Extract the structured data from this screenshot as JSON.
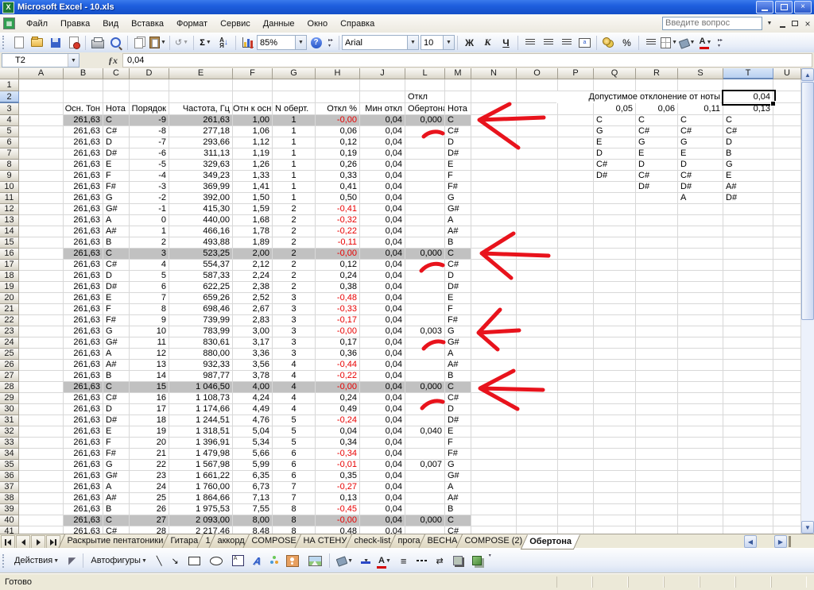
{
  "window": {
    "title": "Microsoft Excel - 10.xls"
  },
  "menu": {
    "items": [
      "Файл",
      "Правка",
      "Вид",
      "Вставка",
      "Формат",
      "Сервис",
      "Данные",
      "Окно",
      "Справка"
    ],
    "question_placeholder": "Введите вопрос"
  },
  "toolbar": {
    "zoom": "85%",
    "font_name": "Arial",
    "font_size": "10",
    "sum": "Σ",
    "sort_a": "А",
    "sort_z": "Я",
    "bold": "Ж",
    "italic": "К",
    "underline": "Ч",
    "percent": "%"
  },
  "formula_bar": {
    "name_box": "T2",
    "fx": "ƒx",
    "value": "0,04"
  },
  "grid": {
    "columns": [
      "A",
      "B",
      "C",
      "D",
      "E",
      "F",
      "G",
      "H",
      "J",
      "L",
      "M",
      "N",
      "O",
      "P",
      "Q",
      "R",
      "S",
      "T",
      "U"
    ],
    "selected_column": "T",
    "selected_row_header": 2,
    "base_tone": "261,63",
    "min_dev": "0,04",
    "row2": {
      "l": "Откл",
      "tolerance_label": "Допустимое отклонение от ноты",
      "t": "0,04"
    },
    "row3": {
      "b": "Осн. Тон",
      "c": "Нота",
      "d": "Порядок",
      "e": "Частота, Гц",
      "f": "Отн к осн",
      "g": "N оберт.",
      "h": "Откл %",
      "j": "Мин откл",
      "l": "Обертона",
      "m": "Нота",
      "q": "0,05",
      "r": "0,06",
      "s": "0,11",
      "t": "0,13"
    },
    "rows": [
      {
        "n": 4,
        "note": "C",
        "ord": "-9",
        "freq": "261,63",
        "ratio": "1,00",
        "ov": "1",
        "dev": "-0,00",
        "ldev": "0,000",
        "gray": true,
        "q": "C",
        "r": "C",
        "s": "C",
        "t": "C"
      },
      {
        "n": 5,
        "note": "C#",
        "ord": "-8",
        "freq": "277,18",
        "ratio": "1,06",
        "ov": "1",
        "dev": "0,06",
        "q": "G",
        "r": "C#",
        "s": "C#",
        "t": "C#"
      },
      {
        "n": 6,
        "note": "D",
        "ord": "-7",
        "freq": "293,66",
        "ratio": "1,12",
        "ov": "1",
        "dev": "0,12",
        "q": "E",
        "r": "G",
        "s": "G",
        "t": "D"
      },
      {
        "n": 7,
        "note": "D#",
        "ord": "-6",
        "freq": "311,13",
        "ratio": "1,19",
        "ov": "1",
        "dev": "0,19",
        "q": "D",
        "r": "E",
        "s": "E",
        "t": "B"
      },
      {
        "n": 8,
        "note": "E",
        "ord": "-5",
        "freq": "329,63",
        "ratio": "1,26",
        "ov": "1",
        "dev": "0,26",
        "q": "C#",
        "r": "D",
        "s": "D",
        "t": "G"
      },
      {
        "n": 9,
        "note": "F",
        "ord": "-4",
        "freq": "349,23",
        "ratio": "1,33",
        "ov": "1",
        "dev": "0,33",
        "q": "D#",
        "r": "C#",
        "s": "C#",
        "t": "E"
      },
      {
        "n": 10,
        "note": "F#",
        "ord": "-3",
        "freq": "369,99",
        "ratio": "1,41",
        "ov": "1",
        "dev": "0,41",
        "r": "D#",
        "s": "D#",
        "t": "A#"
      },
      {
        "n": 11,
        "note": "G",
        "ord": "-2",
        "freq": "392,00",
        "ratio": "1,50",
        "ov": "1",
        "dev": "0,50",
        "s": "A",
        "t": "D#"
      },
      {
        "n": 12,
        "note": "G#",
        "ord": "-1",
        "freq": "415,30",
        "ratio": "1,59",
        "ov": "2",
        "dev": "-0,41"
      },
      {
        "n": 13,
        "note": "A",
        "ord": "0",
        "freq": "440,00",
        "ratio": "1,68",
        "ov": "2",
        "dev": "-0,32"
      },
      {
        "n": 14,
        "note": "A#",
        "ord": "1",
        "freq": "466,16",
        "ratio": "1,78",
        "ov": "2",
        "dev": "-0,22"
      },
      {
        "n": 15,
        "note": "B",
        "ord": "2",
        "freq": "493,88",
        "ratio": "1,89",
        "ov": "2",
        "dev": "-0,11"
      },
      {
        "n": 16,
        "note": "C",
        "ord": "3",
        "freq": "523,25",
        "ratio": "2,00",
        "ov": "2",
        "dev": "-0,00",
        "ldev": "0,000",
        "gray": true
      },
      {
        "n": 17,
        "note": "C#",
        "ord": "4",
        "freq": "554,37",
        "ratio": "2,12",
        "ov": "2",
        "dev": "0,12"
      },
      {
        "n": 18,
        "note": "D",
        "ord": "5",
        "freq": "587,33",
        "ratio": "2,24",
        "ov": "2",
        "dev": "0,24"
      },
      {
        "n": 19,
        "note": "D#",
        "ord": "6",
        "freq": "622,25",
        "ratio": "2,38",
        "ov": "2",
        "dev": "0,38"
      },
      {
        "n": 20,
        "note": "E",
        "ord": "7",
        "freq": "659,26",
        "ratio": "2,52",
        "ov": "3",
        "dev": "-0,48"
      },
      {
        "n": 21,
        "note": "F",
        "ord": "8",
        "freq": "698,46",
        "ratio": "2,67",
        "ov": "3",
        "dev": "-0,33"
      },
      {
        "n": 22,
        "note": "F#",
        "ord": "9",
        "freq": "739,99",
        "ratio": "2,83",
        "ov": "3",
        "dev": "-0,17"
      },
      {
        "n": 23,
        "note": "G",
        "ord": "10",
        "freq": "783,99",
        "ratio": "3,00",
        "ov": "3",
        "dev": "-0,00",
        "ldev": "0,003"
      },
      {
        "n": 24,
        "note": "G#",
        "ord": "11",
        "freq": "830,61",
        "ratio": "3,17",
        "ov": "3",
        "dev": "0,17"
      },
      {
        "n": 25,
        "note": "A",
        "ord": "12",
        "freq": "880,00",
        "ratio": "3,36",
        "ov": "3",
        "dev": "0,36"
      },
      {
        "n": 26,
        "note": "A#",
        "ord": "13",
        "freq": "932,33",
        "ratio": "3,56",
        "ov": "4",
        "dev": "-0,44"
      },
      {
        "n": 27,
        "note": "B",
        "ord": "14",
        "freq": "987,77",
        "ratio": "3,78",
        "ov": "4",
        "dev": "-0,22"
      },
      {
        "n": 28,
        "note": "C",
        "ord": "15",
        "freq": "1 046,50",
        "ratio": "4,00",
        "ov": "4",
        "dev": "-0,00",
        "ldev": "0,000",
        "gray": true
      },
      {
        "n": 29,
        "note": "C#",
        "ord": "16",
        "freq": "1 108,73",
        "ratio": "4,24",
        "ov": "4",
        "dev": "0,24"
      },
      {
        "n": 30,
        "note": "D",
        "ord": "17",
        "freq": "1 174,66",
        "ratio": "4,49",
        "ov": "4",
        "dev": "0,49"
      },
      {
        "n": 31,
        "note": "D#",
        "ord": "18",
        "freq": "1 244,51",
        "ratio": "4,76",
        "ov": "5",
        "dev": "-0,24"
      },
      {
        "n": 32,
        "note": "E",
        "ord": "19",
        "freq": "1 318,51",
        "ratio": "5,04",
        "ov": "5",
        "dev": "0,04",
        "ldev": "0,040"
      },
      {
        "n": 33,
        "note": "F",
        "ord": "20",
        "freq": "1 396,91",
        "ratio": "5,34",
        "ov": "5",
        "dev": "0,34"
      },
      {
        "n": 34,
        "note": "F#",
        "ord": "21",
        "freq": "1 479,98",
        "ratio": "5,66",
        "ov": "6",
        "dev": "-0,34"
      },
      {
        "n": 35,
        "note": "G",
        "ord": "22",
        "freq": "1 567,98",
        "ratio": "5,99",
        "ov": "6",
        "dev": "-0,01",
        "ldev": "0,007"
      },
      {
        "n": 36,
        "note": "G#",
        "ord": "23",
        "freq": "1 661,22",
        "ratio": "6,35",
        "ov": "6",
        "dev": "0,35"
      },
      {
        "n": 37,
        "note": "A",
        "ord": "24",
        "freq": "1 760,00",
        "ratio": "6,73",
        "ov": "7",
        "dev": "-0,27"
      },
      {
        "n": 38,
        "note": "A#",
        "ord": "25",
        "freq": "1 864,66",
        "ratio": "7,13",
        "ov": "7",
        "dev": "0,13"
      },
      {
        "n": 39,
        "note": "B",
        "ord": "26",
        "freq": "1 975,53",
        "ratio": "7,55",
        "ov": "8",
        "dev": "-0,45"
      },
      {
        "n": 40,
        "note": "C",
        "ord": "27",
        "freq": "2 093,00",
        "ratio": "8,00",
        "ov": "8",
        "dev": "-0,00",
        "ldev": "0,000",
        "gray": true
      },
      {
        "n": 41,
        "note": "C#",
        "ord": "28",
        "freq": "2 217,46",
        "ratio": "8,48",
        "ov": "8",
        "dev": "0,48"
      }
    ]
  },
  "annotations": {
    "color": "#e8131c",
    "arrows": [
      "M684 148 L603 151 M641 131 L603 151 L652 186",
      "M690 322 L606 319 M646 294 L606 319 L643 350",
      "M653 416 L602 419 M629 390 L602 419 L626 440",
      "M683 491 L604 489 M646 467 L604 489 L651 515"
    ],
    "checks": [
      "M533 172 C539 166 549 164 557 168",
      "M530 341 C537 333 548 330 557 334",
      "M533 439 C540 431 550 428 558 431",
      "M531 514 C538 506 548 503 557 506"
    ]
  },
  "sheet_tabs": {
    "tabs": [
      "Раскрытие пентатоники",
      "Гитара",
      "1",
      "аккорд",
      "COMPOSE",
      "НА СТЕНУ",
      "check-list",
      "прога",
      "ВЕСНА",
      "COMPOSE (2)",
      "Обертона"
    ],
    "active": "Обертона"
  },
  "drawing_toolbar": {
    "actions_label": "Действия",
    "autoshapes_label": "Автофигуры"
  },
  "status_bar": {
    "text": "Готово"
  }
}
